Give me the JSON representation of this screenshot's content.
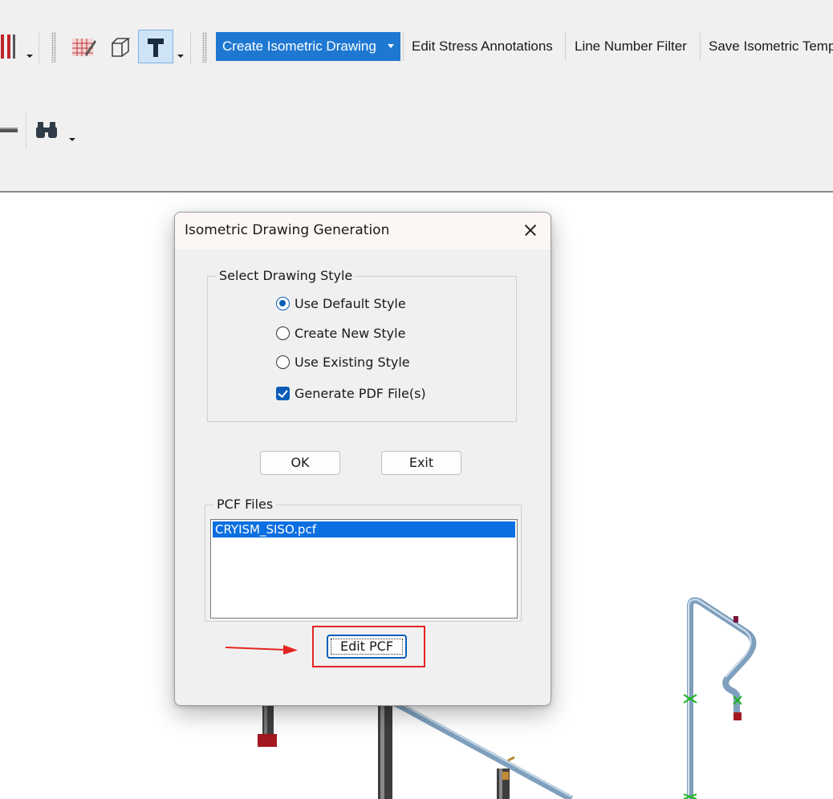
{
  "toolbar": {
    "row1_icons": [
      "red-bars-icon",
      "hatch-icon",
      "box-3d-icon",
      "hammer-icon"
    ],
    "row2_icons": [
      "pipe-icon",
      "binoculars-icon"
    ],
    "commands": [
      {
        "label": "Create Isometric Drawing",
        "active": true,
        "has_dropdown": true
      },
      {
        "label": "Edit Stress Annotations"
      },
      {
        "label": "Line Number Filter"
      },
      {
        "label": "Save Isometric Temp"
      }
    ],
    "accent_color": "#1e78d2"
  },
  "dialog": {
    "title": "Isometric Drawing Generation",
    "style_group": {
      "legend": "Select Drawing Style",
      "options": [
        {
          "label": "Use Default Style",
          "selected": true
        },
        {
          "label": "Create New Style",
          "selected": false
        },
        {
          "label": "Use Existing Style",
          "selected": false
        }
      ],
      "pdf_checkbox": {
        "label": "Generate PDF File(s)",
        "checked": true
      }
    },
    "ok_label": "OK",
    "exit_label": "Exit",
    "pcf_group": {
      "legend": "PCF Files",
      "files": [
        "CRYISM_SISO.pcf"
      ],
      "selected_index": 0
    },
    "edit_pcf_label": "Edit PCF"
  },
  "annotation": {
    "highlight_color": "#e52521",
    "target": "edit-pcf-button"
  }
}
